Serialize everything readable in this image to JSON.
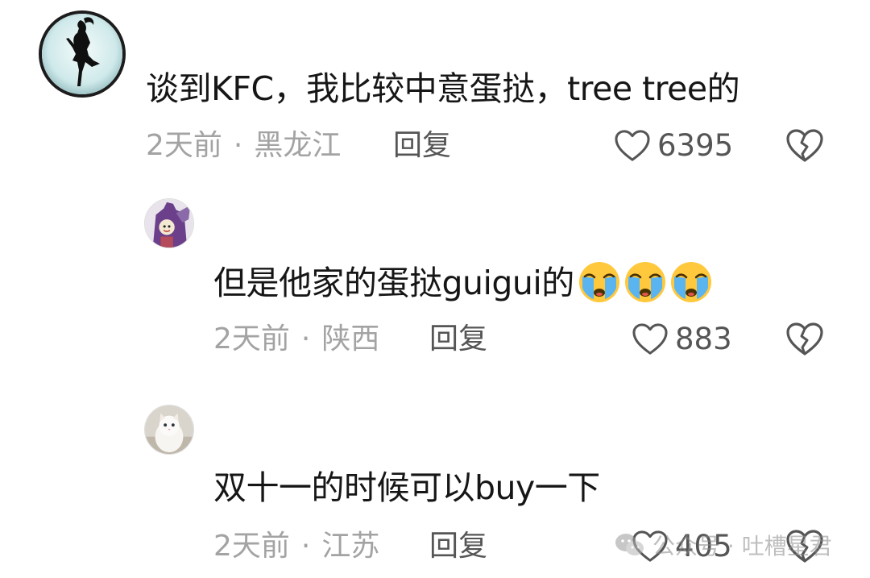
{
  "comments": [
    {
      "text": "谈到KFC，我比较中意蛋挞，tree tree的",
      "time": "2天前",
      "separator": "·",
      "location": "黑龙江",
      "reply_label": "回复",
      "likes": "6395"
    },
    {
      "text": "但是他家的蛋挞guigui的",
      "emojis": [
        "crying-face",
        "crying-face",
        "crying-face"
      ],
      "time": "2天前",
      "separator": "·",
      "location": "陕西",
      "reply_label": "回复",
      "likes": "883"
    },
    {
      "text": "双十一的时候可以buy一下",
      "time": "2天前",
      "separator": "·",
      "location": "江苏",
      "reply_label": "回复",
      "likes": "405"
    }
  ],
  "watermark": {
    "icon": "wechat-icon",
    "text": "公众号 · 吐槽星君"
  },
  "colors": {
    "text": "#161616",
    "meta": "#a3a3a3",
    "action": "#555555",
    "background": "#ffffff"
  }
}
